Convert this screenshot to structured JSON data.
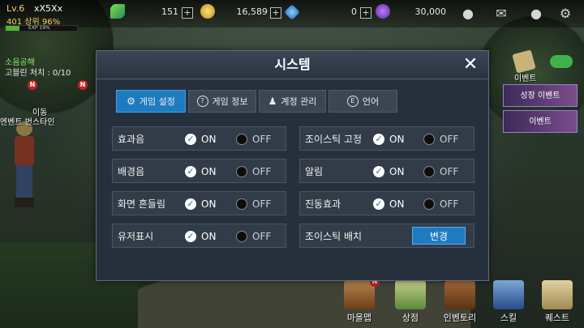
{
  "player": {
    "level": "Lv.6",
    "name": "xX5Xx",
    "rank": "401 상위 96%",
    "exp_label": "EXP 19%",
    "exp_percent": 19
  },
  "currencies": [
    {
      "icon": "feather-icon",
      "value": "151"
    },
    {
      "icon": "gold-coin-icon",
      "value": "16,589"
    },
    {
      "icon": "gem-icon",
      "value": "0"
    },
    {
      "icon": "crystal-icon",
      "value": "30,000"
    }
  ],
  "top_icons": [
    "profile-icon",
    "mail-icon",
    "chat-icon",
    "settings-gear-icon"
  ],
  "quest": {
    "title": "소음공해",
    "progress": "고블린 처치 : 0/10"
  },
  "side_labels": {
    "event": "이벤트",
    "banner1": "성장 이벤트",
    "banner2": "이벤트",
    "left_text1": "이동",
    "left_text2": "엔벤트 번스타인"
  },
  "dialog": {
    "title": "시스템",
    "close_icon": "close-icon",
    "tabs": [
      {
        "label": "게임 설정",
        "icon": "gear-icon",
        "active": true
      },
      {
        "label": "게임 정보",
        "icon": "question-icon",
        "active": false
      },
      {
        "label": "계정 관리",
        "icon": "user-icon",
        "active": false
      },
      {
        "label": "언어",
        "icon": "language-e-icon",
        "active": false
      }
    ],
    "on_label": "ON",
    "off_label": "OFF",
    "settings_left": [
      {
        "label": "효과음",
        "value": "ON"
      },
      {
        "label": "배경음",
        "value": "ON"
      },
      {
        "label": "화면 흔들림",
        "value": "ON"
      },
      {
        "label": "유저표시",
        "value": "ON"
      }
    ],
    "settings_right": [
      {
        "label": "조이스틱 고정",
        "value": "ON"
      },
      {
        "label": "알림",
        "value": "ON"
      },
      {
        "label": "진동효과",
        "value": "ON"
      }
    ],
    "joystick_position": {
      "label": "조이스틱 배치",
      "button": "변경"
    }
  },
  "bottom_menu": [
    {
      "label": "마을맵",
      "icon": "town-map-icon",
      "badge": "N"
    },
    {
      "label": "상점",
      "icon": "shop-icon"
    },
    {
      "label": "인벤토리",
      "icon": "inventory-icon"
    },
    {
      "label": "스킬",
      "icon": "skill-icon"
    },
    {
      "label": "퀘스트",
      "icon": "quest-scroll-icon"
    }
  ],
  "colors": {
    "accent_blue": "#1f7bc0",
    "dialog_bg": "#26303d",
    "quest_green": "#8de46a",
    "gold": "#f3d27a"
  }
}
